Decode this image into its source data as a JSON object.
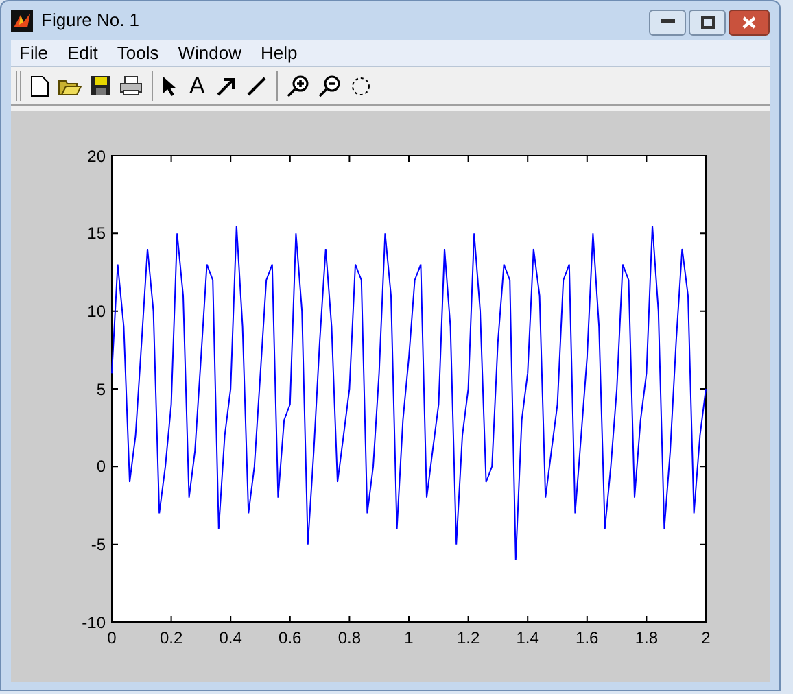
{
  "window": {
    "title": "Figure No. 1"
  },
  "menu": [
    {
      "label": "File"
    },
    {
      "label": "Edit"
    },
    {
      "label": "Tools"
    },
    {
      "label": "Window"
    },
    {
      "label": "Help"
    }
  ],
  "toolbar": {
    "text_tool": "A"
  },
  "plot": {
    "chart_data": {
      "type": "line",
      "x": [
        0,
        0.02,
        0.04,
        0.06,
        0.08,
        0.1,
        0.12,
        0.14,
        0.16,
        0.18,
        0.2,
        0.22,
        0.24,
        0.26,
        0.28,
        0.3,
        0.32,
        0.34,
        0.36,
        0.38,
        0.4,
        0.42,
        0.44,
        0.46,
        0.48,
        0.5,
        0.52,
        0.54,
        0.56,
        0.58,
        0.6,
        0.62,
        0.64,
        0.66,
        0.68,
        0.7,
        0.72,
        0.74,
        0.76,
        0.78,
        0.8,
        0.82,
        0.84,
        0.86,
        0.88,
        0.9,
        0.92,
        0.94,
        0.96,
        0.98,
        1,
        1.02,
        1.04,
        1.06,
        1.08,
        1.1,
        1.12,
        1.14,
        1.16,
        1.18,
        1.2,
        1.22,
        1.24,
        1.26,
        1.28,
        1.3,
        1.32,
        1.34,
        1.36,
        1.38,
        1.4,
        1.42,
        1.44,
        1.46,
        1.48,
        1.5,
        1.52,
        1.54,
        1.56,
        1.58,
        1.6,
        1.62,
        1.64,
        1.66,
        1.68,
        1.7,
        1.72,
        1.74,
        1.76,
        1.78,
        1.8,
        1.82,
        1.84,
        1.86,
        1.88,
        1.9,
        1.92,
        1.94,
        1.96,
        1.98,
        2
      ],
      "series": [
        {
          "color": "#0000ff",
          "values": [
            6,
            13,
            9,
            -1,
            2,
            8,
            14,
            10,
            -3,
            0,
            4,
            15,
            11,
            -2,
            1,
            7,
            13,
            12,
            -4,
            2,
            5,
            15.5,
            9,
            -3,
            0,
            6,
            12,
            13,
            -2,
            3,
            4,
            15,
            10,
            -5,
            1,
            8,
            14,
            9,
            -1,
            2,
            5,
            13,
            12,
            -3,
            0,
            6,
            15,
            11,
            -4,
            3,
            7,
            12,
            13,
            -2,
            1,
            4,
            14,
            9,
            -5,
            2,
            5,
            15,
            10,
            -1,
            0,
            8,
            13,
            12,
            -6,
            3,
            6,
            14,
            11,
            -2,
            1,
            4,
            12,
            13,
            -3,
            2,
            7,
            15,
            9,
            -4,
            0,
            5,
            13,
            12,
            -2,
            3,
            6,
            15.5,
            10,
            -4,
            1,
            8,
            14,
            11,
            -3,
            2,
            5
          ]
        }
      ],
      "xlim": [
        0,
        2
      ],
      "ylim": [
        -10,
        20
      ],
      "xticks": [
        0,
        0.2,
        0.4,
        0.6,
        0.8,
        1,
        1.2,
        1.4,
        1.6,
        1.8,
        2
      ],
      "yticks": [
        -10,
        -5,
        0,
        5,
        10,
        15,
        20
      ]
    }
  }
}
